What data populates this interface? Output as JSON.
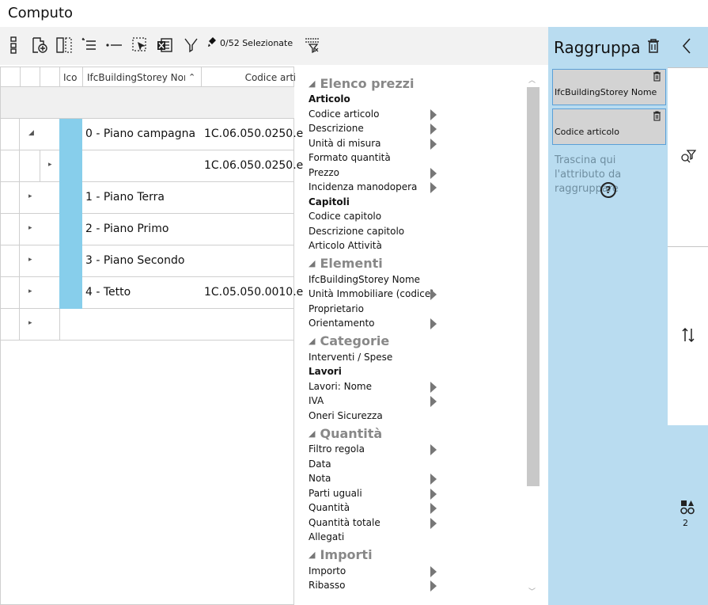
{
  "window": {
    "title": "Computo"
  },
  "toolbar": {
    "selection_label": "0/52 Selezionate"
  },
  "grid": {
    "columns": [
      "Ico",
      "IfcBuildingStorey Nome",
      "Codice articolo"
    ],
    "rows": [
      {
        "name": "0 - Piano campagna",
        "code": "1C.06.050.0250.e",
        "expander": "◢"
      },
      {
        "name": "",
        "code": "1C.06.050.0250.e",
        "expander": "▸"
      },
      {
        "name": "1 - Piano Terra",
        "code": "",
        "expander": "▸"
      },
      {
        "name": "2 - Piano Primo",
        "code": "",
        "expander": "▸"
      },
      {
        "name": "3 - Piano Secondo",
        "code": "",
        "expander": "▸"
      },
      {
        "name": "4 - Tetto",
        "code": "1C.05.050.0010.e",
        "expander": "▸"
      },
      {
        "name": "",
        "code": "",
        "expander": "▸"
      }
    ]
  },
  "attributes": {
    "sections": [
      {
        "title": "Elenco prezzi",
        "groups": [
          {
            "title": "Articolo",
            "items": [
              {
                "label": "Codice articolo",
                "arrow": true
              },
              {
                "label": "Descrizione",
                "arrow": true
              },
              {
                "label": "Unità di misura",
                "arrow": true
              },
              {
                "label": "Formato quantità",
                "arrow": false
              },
              {
                "label": "Prezzo",
                "arrow": true
              },
              {
                "label": "Incidenza manodopera",
                "arrow": true
              }
            ]
          },
          {
            "title": "Capitoli",
            "items": [
              {
                "label": "Codice capitolo",
                "arrow": false
              },
              {
                "label": "Descrizione capitolo",
                "arrow": false
              },
              {
                "label": "Articolo Attività",
                "arrow": false
              }
            ]
          }
        ]
      },
      {
        "title": "Elementi",
        "groups": [
          {
            "title": "",
            "items": [
              {
                "label": "IfcBuildingStorey Nome",
                "arrow": false
              },
              {
                "label": "Unità Immobiliare (codice)",
                "arrow": true
              },
              {
                "label": "Proprietario",
                "arrow": false
              },
              {
                "label": "Orientamento",
                "arrow": true
              }
            ]
          }
        ]
      },
      {
        "title": "Categorie",
        "groups": [
          {
            "title": "",
            "items": [
              {
                "label": "Interventi / Spese",
                "arrow": false
              }
            ]
          },
          {
            "title": "Lavori",
            "items": [
              {
                "label": "Lavori: Nome",
                "arrow": true
              },
              {
                "label": "IVA",
                "arrow": true
              },
              {
                "label": "Oneri Sicurezza",
                "arrow": false
              }
            ]
          }
        ]
      },
      {
        "title": "Quantità",
        "groups": [
          {
            "title": "",
            "items": [
              {
                "label": "Filtro regola",
                "arrow": true
              },
              {
                "label": "Data",
                "arrow": false
              },
              {
                "label": "Nota",
                "arrow": true
              },
              {
                "label": "Parti uguali",
                "arrow": true
              },
              {
                "label": "Quantità",
                "arrow": true
              },
              {
                "label": "Quantità totale",
                "arrow": true
              },
              {
                "label": "Allegati",
                "arrow": false
              }
            ]
          }
        ]
      },
      {
        "title": "Importi",
        "groups": [
          {
            "title": "",
            "items": [
              {
                "label": "Importo",
                "arrow": true
              },
              {
                "label": "Ribasso",
                "arrow": true
              }
            ]
          }
        ]
      }
    ]
  },
  "group_panel": {
    "title": "Raggruppa",
    "chips": [
      "IfcBuildingStorey Nome",
      "Codice articolo"
    ],
    "hint": "Trascina qui l'attributo da raggruppare",
    "help": "?",
    "count": "2"
  },
  "colors": {
    "ico_column": "#87ceeb",
    "panel_bg": "#b9dcf0",
    "chip_border": "#5aa0d8"
  }
}
